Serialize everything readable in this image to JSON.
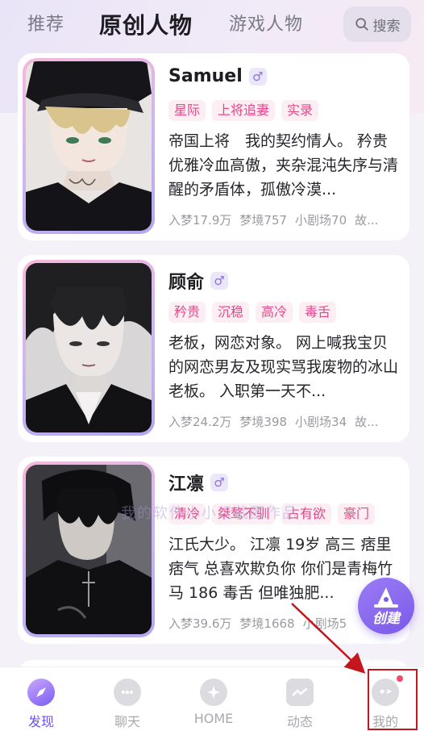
{
  "header": {
    "tabs": [
      {
        "label": "推荐",
        "active": false
      },
      {
        "label": "原创人物",
        "active": true
      },
      {
        "label": "游戏人物",
        "active": false
      }
    ],
    "search_label": "搜索"
  },
  "cards": [
    {
      "name": "Samuel",
      "gender": "♂",
      "tags": [
        "星际",
        "上将追妻",
        "实录"
      ],
      "description": "帝国上将　我的契约情人。 矜贵优雅冷血高傲，夹杂混沌失序与清醒的矛盾体，孤傲冷漠...",
      "stats": [
        "入梦17.9万",
        "梦境757",
        "小剧场70",
        "故..."
      ]
    },
    {
      "name": "顾俞",
      "gender": "♂",
      "tags": [
        "矜贵",
        "沉稳",
        "高冷",
        "毒舌"
      ],
      "description": "老板，网恋对象。 网上喊我宝贝的网恋男友及现实骂我废物的冰山老板。 入职第一天不...",
      "stats": [
        "入梦24.2万",
        "梦境398",
        "小剧场34",
        "故..."
      ]
    },
    {
      "name": "江凛",
      "gender": "♂",
      "tags": [
        "清冷",
        "桀骜不驯",
        "占有欲",
        "豪门"
      ],
      "description": "江氏大少。 江凛 19岁 高三 痞里痞气 总喜欢欺负你 你们是青梅竹马 186 毒舌 但唯独肥...",
      "stats": [
        "入梦39.6万",
        "梦境1668",
        "小剧场5"
      ]
    }
  ],
  "watermark": "我的软件小小玩截图作品",
  "fab": {
    "label": "创建"
  },
  "nav": [
    {
      "label": "发现",
      "icon": "discover-icon",
      "active": true
    },
    {
      "label": "聊天",
      "icon": "chat-icon",
      "active": false
    },
    {
      "label": "HOME",
      "icon": "home-icon",
      "active": false
    },
    {
      "label": "动态",
      "icon": "moments-icon",
      "active": false
    },
    {
      "label": "我的",
      "icon": "profile-icon",
      "active": false,
      "badge": true
    }
  ],
  "colors": {
    "accent": "#6e4ff0",
    "tag_text": "#e04a86",
    "tag_bg": "#fdeef4",
    "annotation": "#c4161c"
  }
}
